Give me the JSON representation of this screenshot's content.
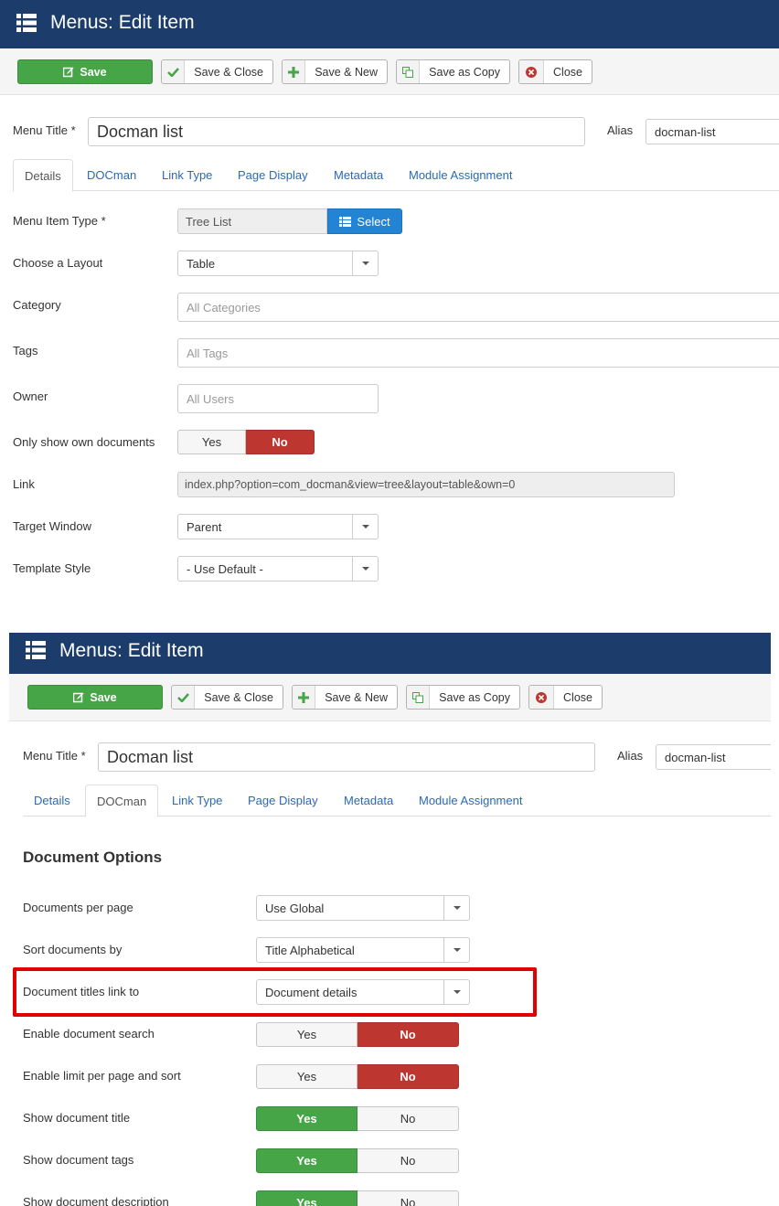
{
  "screen1": {
    "header": {
      "title": "Menus: Edit Item",
      "icon": "list-icon"
    },
    "toolbar": {
      "save": "Save",
      "save_close": "Save & Close",
      "save_new": "Save & New",
      "save_copy": "Save as Copy",
      "close": "Close"
    },
    "form": {
      "menu_title_label": "Menu Title *",
      "menu_title_value": "Docman list",
      "alias_label": "Alias",
      "alias_value": "docman-list"
    },
    "tabs": [
      "Details",
      "DOCman",
      "Link Type",
      "Page Display",
      "Metadata",
      "Module Assignment"
    ],
    "active_tab": "Details",
    "fields": {
      "menu_item_type_label": "Menu Item Type *",
      "menu_item_type_value": "Tree List",
      "select_button": "Select",
      "layout_label": "Choose a Layout",
      "layout_value": "Table",
      "category_label": "Category",
      "category_placeholder": "All Categories",
      "tags_label": "Tags",
      "tags_placeholder": "All Tags",
      "owner_label": "Owner",
      "owner_placeholder": "All Users",
      "own_docs_label": "Only show own documents",
      "yes": "Yes",
      "no": "No",
      "link_label": "Link",
      "link_value": "index.php?option=com_docman&view=tree&layout=table&own=0",
      "target_label": "Target Window",
      "target_value": "Parent",
      "template_label": "Template Style",
      "template_value": "- Use Default -"
    }
  },
  "screen2": {
    "header": {
      "title": "Menus: Edit Item",
      "icon": "list-icon"
    },
    "toolbar": {
      "save": "Save",
      "save_close": "Save & Close",
      "save_new": "Save & New",
      "save_copy": "Save as Copy",
      "close": "Close"
    },
    "form": {
      "menu_title_label": "Menu Title *",
      "menu_title_value": "Docman list",
      "alias_label": "Alias",
      "alias_value": "docman-list"
    },
    "tabs": [
      "Details",
      "DOCman",
      "Link Type",
      "Page Display",
      "Metadata",
      "Module Assignment"
    ],
    "active_tab": "DOCman",
    "section_title": "Document Options",
    "options": {
      "per_page_label": "Documents per page",
      "per_page_value": "Use Global",
      "sort_label": "Sort documents by",
      "sort_value": "Title Alphabetical",
      "titles_link_label": "Document titles link to",
      "titles_link_value": "Document details",
      "search_label": "Enable document search",
      "limit_label": "Enable limit per page and sort",
      "show_title_label": "Show document title",
      "show_tags_label": "Show document tags",
      "show_desc_label": "Show document description",
      "yes": "Yes",
      "no": "No"
    },
    "highlight_color": "#e00000"
  },
  "colors": {
    "header_bg": "#1c3d6b",
    "save_green": "#46a546",
    "no_red": "#bd362f",
    "select_blue": "#2384d3",
    "link_blue": "#2a69b8"
  }
}
